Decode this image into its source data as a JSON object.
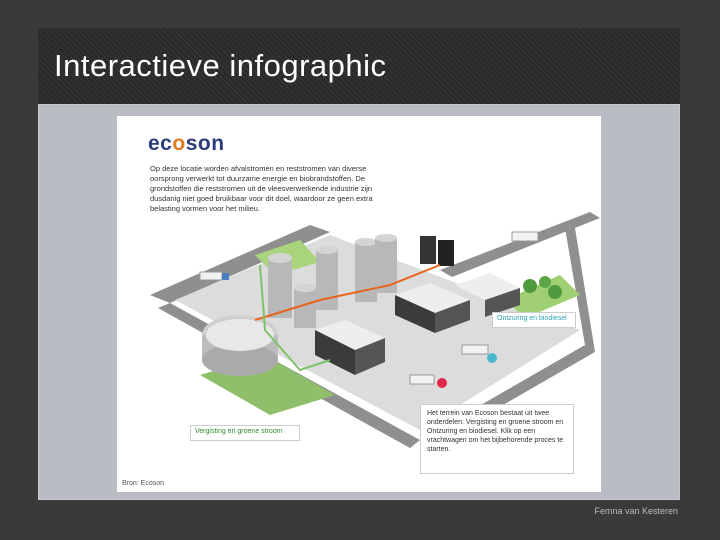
{
  "slide": {
    "title": "Interactieve infographic",
    "footer": "Femna van Kesteren"
  },
  "infographic": {
    "logo": {
      "prefix": "ec",
      "o": "o",
      "suffix": "son"
    },
    "intro": "Op deze locatie worden afvalstromen en reststromen van diverse oorsprong verwerkt tot duurzame energie en biobrandstoffen. De grondstoffen die reststromen uit de vleesverwerkende industrie zijn dusdanig niet goed bruikbaar voor dit doel, waardoor ze geen extra belasting vormen voor het milieu.",
    "source": "Bron: Ecoson",
    "callout_right": "Ontzuring en biodiesel",
    "callout_left": "Vergisting en groene stroom",
    "info_box": "Het terrein van Ecoson bestaat uit twee onderdelen: Vergisting en groene stroom en Ontzuring en biodiesel. Klik op een vrachtwagen om het bijbehorende proces te starten.",
    "colors": {
      "accent_orange": "#e07a1f",
      "brand_blue": "#2c3d7a",
      "green_pipe": "#7cc26a",
      "orange_pipe": "#e8641c"
    }
  }
}
